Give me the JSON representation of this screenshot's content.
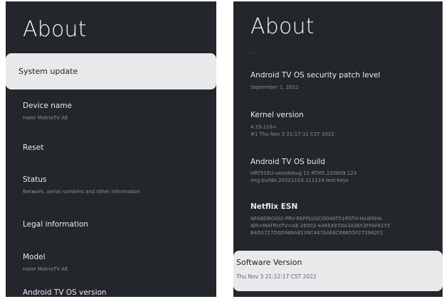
{
  "left": {
    "title": "About",
    "selected_item": "System update",
    "items": [
      {
        "label": "Device name",
        "sub": "Haier MatrixTV AE"
      },
      {
        "label": "Reset",
        "sub": ""
      },
      {
        "label": "Status",
        "sub": "Network, serial numbers and other information"
      },
      {
        "label": "Legal information",
        "sub": ""
      },
      {
        "label": "Model",
        "sub": "Haier MatrixTV AE"
      },
      {
        "label": "Android TV OS version",
        "sub": ""
      }
    ]
  },
  "right": {
    "title": "About",
    "dots": "..",
    "items": [
      {
        "label": "Android TV OS security patch level",
        "sub": "September 1, 2022",
        "sub2": ""
      },
      {
        "label": "Kernel version",
        "sub": "4.19.116+",
        "sub2": "#1 Thu Nov 3 21:17:11 CST 2022"
      },
      {
        "label": "Android TV OS build",
        "sub": "HRT51EU-userdebug 11 RTM5.220609.123",
        "sub2": "eng.builde.20221103.211114 test-keys"
      },
      {
        "label": "Netflix ESN",
        "sub": "NFANDROID2-PRV-REFPLUSCOO4KT51PGTV-HAIERHA",
        "sub2": "IER=MATRIXTV=AE-26502-4485497DA3A3EF2FFAF6155",
        "sub3": "B4D0727D0D988A8139C447EAE6C66855F272962F2"
      }
    ],
    "selected": {
      "label": "Software Version",
      "sub": "Thu Nov 3 21:12:17 CST 2022"
    }
  }
}
